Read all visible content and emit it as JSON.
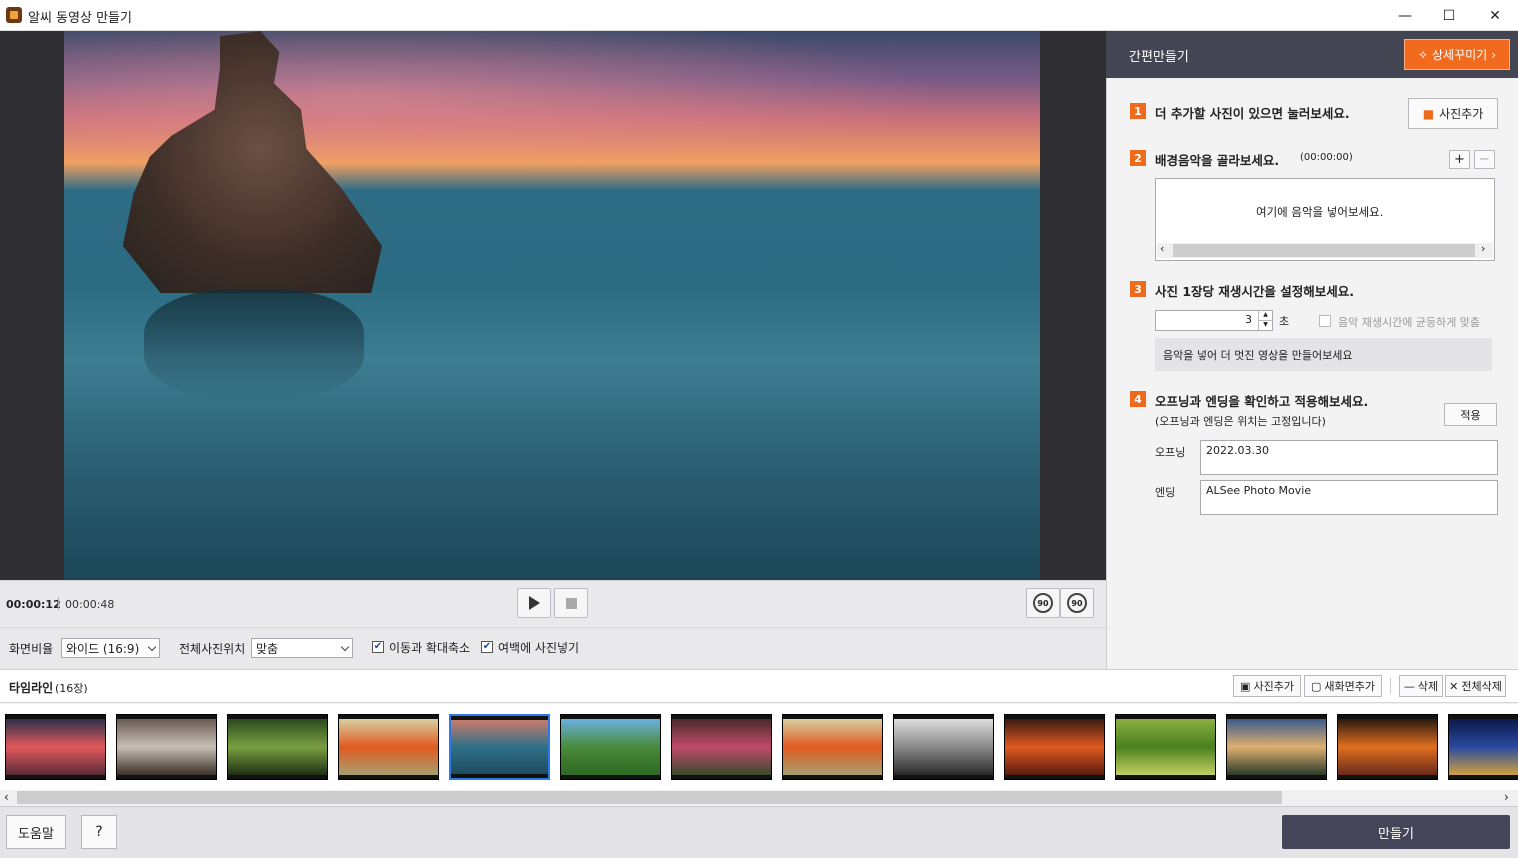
{
  "window": {
    "title": "알씨 동영상 만들기",
    "minimize": "—",
    "maximize": "☐",
    "close": "✕"
  },
  "player": {
    "current_time": "00:00:12",
    "total_time": "00:00:48",
    "rotate_left_label": "90",
    "rotate_right_label": "90"
  },
  "options": {
    "aspect_label": "화면비율",
    "aspect_value": "와이드 (16:9)",
    "position_label": "전체사진위치",
    "position_value": "맞춤",
    "pan_zoom_label": "이동과 확대축소",
    "pan_zoom_checked": true,
    "fill_margin_label": "여백에 사진넣기",
    "fill_margin_checked": true
  },
  "panel": {
    "title": "간편만들기",
    "detail_button": "상세꾸미기",
    "step1": {
      "num": "1",
      "text": "더 추가할 사진이 있으면 눌러보세요.",
      "button": "사진추가"
    },
    "step2": {
      "num": "2",
      "text": "배경음악을 골라보세요.",
      "duration": "(00:00:00)",
      "plus": "+",
      "minus": "−",
      "drop_hint": "여기에 음악을 넣어보세요."
    },
    "step3": {
      "num": "3",
      "text": "사진 1장당 재생시간을 설정해보세요.",
      "seconds_value": "3",
      "seconds_unit": "초",
      "sync_label": "음악 재생시간에 균등하게 맞춤",
      "sync_checked": false,
      "hint": "음악을 넣어 더 멋진 영상을 만들어보세요"
    },
    "step4": {
      "num": "4",
      "text": "오프닝과 엔딩을 확인하고 적용해보세요.",
      "subtext": "(오프닝과 엔딩은 위치는 고정입니다)",
      "apply_button": "적용",
      "opening_label": "오프닝",
      "opening_value": "2022.03.30",
      "ending_label": "엔딩",
      "ending_value": "ALSee Photo Movie"
    }
  },
  "timeline": {
    "label": "타임라인",
    "count": "(16장)",
    "add_photo": "사진추가",
    "add_screen": "새화면추가",
    "delete": "삭제",
    "delete_all": "전체삭제",
    "thumbnails": [
      {
        "name": "sunset-beach",
        "colors": [
          "#2c2e4a",
          "#e25a5a",
          "#5a2a3a"
        ],
        "selected": false
      },
      {
        "name": "squirrel",
        "colors": [
          "#6a5a50",
          "#c8c0b8",
          "#3a3028"
        ],
        "selected": false
      },
      {
        "name": "plant-leaves",
        "colors": [
          "#2a4a1e",
          "#7aa040",
          "#1e3014"
        ],
        "selected": false
      },
      {
        "name": "red-poppy",
        "colors": [
          "#d8d0a0",
          "#e05a20",
          "#a8a070"
        ],
        "selected": false
      },
      {
        "name": "sea-rock",
        "colors": [
          "#c87a6a",
          "#2f7088",
          "#1e4c5e"
        ],
        "selected": true
      },
      {
        "name": "green-field",
        "colors": [
          "#6ab0e0",
          "#4a8a3a",
          "#2e6a24"
        ],
        "selected": false
      },
      {
        "name": "pink-flowers",
        "colors": [
          "#4a2a2a",
          "#c04a6a",
          "#3a4a2a"
        ],
        "selected": false
      },
      {
        "name": "red-poppy-2",
        "colors": [
          "#d8d0a0",
          "#e05a20",
          "#a8a070"
        ],
        "selected": false
      },
      {
        "name": "cracked-earth",
        "colors": [
          "#dcdcdc",
          "#8a8a8a",
          "#2a2a2a"
        ],
        "selected": false
      },
      {
        "name": "fire-sky",
        "colors": [
          "#3a1a10",
          "#e05a20",
          "#5a1a10"
        ],
        "selected": false
      },
      {
        "name": "green-frog",
        "colors": [
          "#8ab040",
          "#4a8020",
          "#c0d060"
        ],
        "selected": false
      },
      {
        "name": "coast-sunset",
        "colors": [
          "#3a5a8a",
          "#e0b070",
          "#2a3a2a"
        ],
        "selected": false
      },
      {
        "name": "tropical-flower",
        "colors": [
          "#2a1a10",
          "#e07020",
          "#6a2a1a"
        ],
        "selected": false
      },
      {
        "name": "blue-night",
        "colors": [
          "#0a1a4a",
          "#2a4aa0",
          "#d0a040"
        ],
        "selected": false
      }
    ]
  },
  "footer": {
    "help": "도움말",
    "question": "?",
    "make": "만들기"
  }
}
